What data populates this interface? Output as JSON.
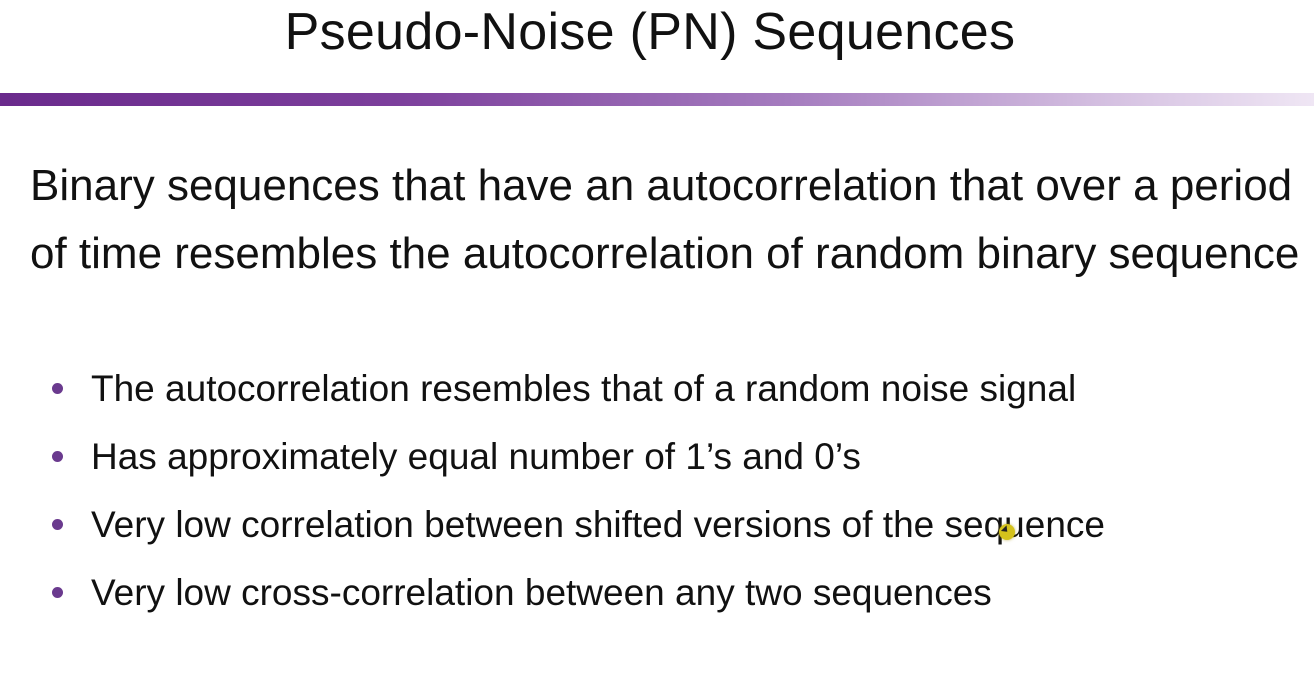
{
  "slide": {
    "title": "Pseudo-Noise (PN) Sequences",
    "intro": "Binary sequences that have an autocorrelation that over a period of time resembles the autocorrelation of random binary sequence",
    "bullets": [
      "The autocorrelation resembles that of a random noise signal",
      "Has approximately equal number of 1’s and 0’s",
      "Very low correlation between shifted versions of the sequence",
      "Very low cross-correlation between any two sequences"
    ]
  },
  "colors": {
    "accent": "#6a2a8c",
    "bullet": "#6a3a8e",
    "cursor": "#d4c21c"
  }
}
